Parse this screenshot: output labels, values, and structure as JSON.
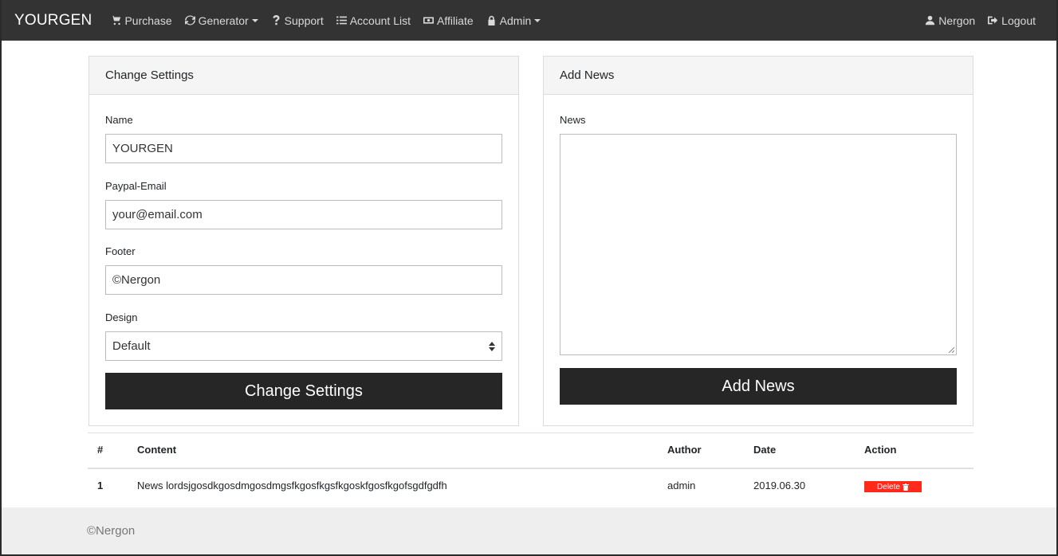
{
  "navbar": {
    "brand": "YOURGEN",
    "items": [
      {
        "label": "Purchase",
        "icon": "cart-icon"
      },
      {
        "label": "Generator",
        "icon": "refresh-icon",
        "dropdown": true
      },
      {
        "label": "Support",
        "icon": "question-icon"
      },
      {
        "label": "Account List",
        "icon": "list-icon"
      },
      {
        "label": "Affiliate",
        "icon": "money-icon"
      },
      {
        "label": "Admin",
        "icon": "lock-icon",
        "dropdown": true
      }
    ],
    "right": [
      {
        "label": "Nergon",
        "icon": "user-icon"
      },
      {
        "label": "Logout",
        "icon": "logout-icon"
      }
    ]
  },
  "settings": {
    "header": "Change Settings",
    "name_label": "Name",
    "name_value": "YOURGEN",
    "paypal_label": "Paypal-Email",
    "paypal_value": "your@email.com",
    "footer_label": "Footer",
    "footer_value": "©Nergon",
    "design_label": "Design",
    "design_value": "Default",
    "submit": "Change Settings"
  },
  "news": {
    "header": "Add News",
    "news_label": "News",
    "news_value": "",
    "submit": "Add News"
  },
  "table": {
    "headers": [
      "#",
      "Content",
      "Author",
      "Date",
      "Action"
    ],
    "rows": [
      {
        "id": "1",
        "content": "News lordsjgosdkgosdmgosdmgsfkgosfkgsfkgoskfgosfkgofsgdfgdfh",
        "author": "admin",
        "date": "2019.06.30",
        "action": "Delete"
      }
    ]
  },
  "footer": {
    "text": "©Nergon"
  },
  "colors": {
    "navbar": "#333333",
    "button_dark": "#262626",
    "delete": "#ff2a1a"
  }
}
